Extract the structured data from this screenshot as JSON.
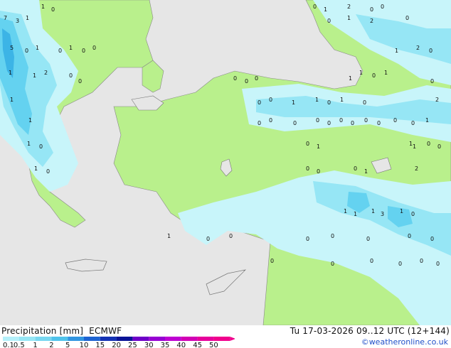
{
  "title": {
    "variable": "Precipitation [mm]",
    "model": "ECMWF"
  },
  "valid_time": "Tu 17-03-2026 09..12 UTC (12+144)",
  "credit": "©weatheronline.co.uk",
  "legend": {
    "ticks": [
      "0.1",
      "0.5",
      "1",
      "2",
      "5",
      "10",
      "15",
      "20",
      "25",
      "30",
      "35",
      "40",
      "45",
      "50"
    ],
    "colors": [
      "#b4f0fa",
      "#96e6f5",
      "#78d7f0",
      "#50c3eb",
      "#3296e1",
      "#1e64d2",
      "#1432b4",
      "#0a1496",
      "#6e00c8",
      "#9600d2",
      "#be00d2",
      "#d200b4",
      "#e6009b",
      "#f0008c"
    ]
  },
  "map_colors": {
    "sea": "#e6e6e6",
    "land_dry": "#b9f08c",
    "precip_light": "#c8f5fa",
    "precip_medium": "#96e6f5",
    "precip_heavy": "#64d2f0",
    "precip_core": "#3cb4e6"
  },
  "grid_values": {
    "row1": [
      "1",
      "0",
      "0",
      "1",
      "2",
      "0",
      "0"
    ],
    "row2": [
      "7",
      "3",
      "1",
      "0",
      "1",
      "2",
      "0"
    ],
    "row3": [
      "5",
      "0",
      "1",
      "0",
      "1",
      "0",
      "0",
      "1",
      "2",
      "0"
    ],
    "row4": [
      "1",
      "1",
      "2",
      "0",
      "1",
      "0",
      "1"
    ],
    "row5": [
      "0",
      "0",
      "0",
      "0",
      "1",
      "0"
    ],
    "row6": [
      "1",
      "0",
      "0",
      "1",
      "1",
      "0",
      "1",
      "0",
      "2"
    ],
    "row7": [
      "1",
      "0",
      "0",
      "0",
      "0",
      "0",
      "0",
      "0",
      "0",
      "0",
      "0",
      "0",
      "1"
    ],
    "row8": [
      "1",
      "0",
      "0",
      "1",
      "0",
      "0",
      "1",
      "1"
    ],
    "row9": [
      "1",
      "0",
      "0",
      "0",
      "0",
      "1",
      "2"
    ],
    "row10": [
      "1",
      "1",
      "1",
      "3",
      "1",
      "0"
    ],
    "row11": [
      "1",
      "0",
      "0",
      "0",
      "0",
      "0",
      "0",
      "0"
    ],
    "row12": [
      "0",
      "0",
      "0",
      "0",
      "0",
      "0"
    ]
  }
}
